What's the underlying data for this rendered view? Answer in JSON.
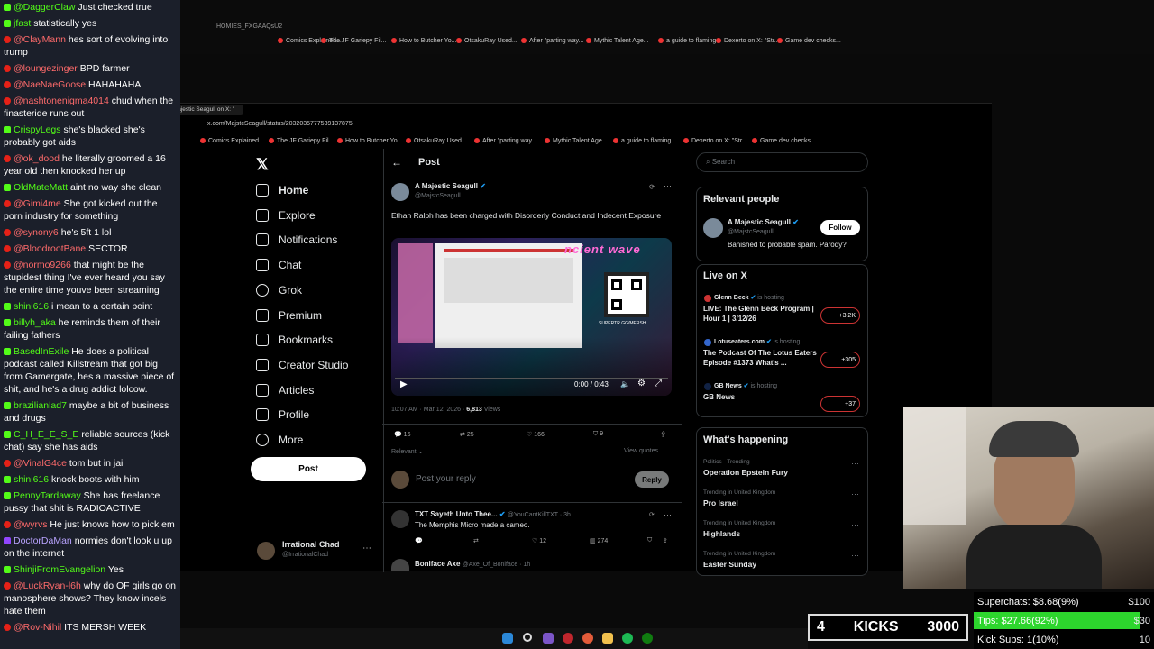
{
  "chat": [
    {
      "badge": "kick",
      "user": "@DaggerClaw",
      "text": "Just checked true"
    },
    {
      "badge": "kick",
      "user": "jfast",
      "text": "statistically yes"
    },
    {
      "badge": "yt",
      "user": "@ClayMann",
      "text": "hes sort of evolving into trump"
    },
    {
      "badge": "yt",
      "user": "@loungezinger",
      "text": "BPD farmer"
    },
    {
      "badge": "yt",
      "user": "@NaeNaeGoose",
      "text": "HAHAHAHA"
    },
    {
      "badge": "yt",
      "user": "@nashtonenigma4014",
      "text": "chud when the finasteride runs out"
    },
    {
      "badge": "kick",
      "user": "CrispyLegs",
      "text": "she's blacked she's probably got aids"
    },
    {
      "badge": "yt",
      "user": "@ok_dood",
      "text": "he literally groomed a 16 year old then knocked her up"
    },
    {
      "badge": "kick",
      "user": "OldMateMatt",
      "text": "aint no way she clean"
    },
    {
      "badge": "yt",
      "user": "@Gimi4me",
      "text": "She got kicked out the porn industry for something"
    },
    {
      "badge": "yt",
      "user": "@synony6",
      "text": "he's 5ft 1 lol"
    },
    {
      "badge": "yt",
      "user": "@BloodrootBane",
      "text": "SECTOR"
    },
    {
      "badge": "yt",
      "user": "@normo9266",
      "text": "that might be the stupidest thing I've ever heard you say the entire time youve been streaming"
    },
    {
      "badge": "kick",
      "user": "shini616",
      "text": "i mean to a certain point"
    },
    {
      "badge": "kick",
      "user": "billyh_aka",
      "text": "he reminds them of their failing fathers"
    },
    {
      "badge": "kick",
      "user": "BasedInExile",
      "text": "He does a political podcast called Killstream that got big from Gamergate, hes a massive piece of shit, and he's a drug addict lolcow."
    },
    {
      "badge": "kick",
      "user": "brazilianlad7",
      "text": "maybe a bit of business and drugs"
    },
    {
      "badge": "kick",
      "user": "C_H_E_E_S_E",
      "text": "reliable sources (kick chat) say she has aids"
    },
    {
      "badge": "yt",
      "user": "@VinalG4ce",
      "text": "tom but in jail"
    },
    {
      "badge": "kick",
      "user": "shini616",
      "text": "knock boots with him"
    },
    {
      "badge": "kick",
      "user": "PennyTardaway",
      "text": "She has freelance pussy that shit is RADIOACTIVE"
    },
    {
      "badge": "yt",
      "user": "@wyrvs",
      "text": "He just knows how to pick em"
    },
    {
      "badge": "tw",
      "user": "DoctorDaMan",
      "text": "normies don't look u up on the internet"
    },
    {
      "badge": "kick",
      "user": "ShinjiFromEvangelion",
      "text": "Yes"
    },
    {
      "badge": "yt",
      "user": "@LuckRyan-l6h",
      "text": "why do OF girls go on manosphere shows? They know incels hate them"
    },
    {
      "badge": "yt",
      "user": "@Rov-Nihil",
      "text": "ITS MERSH WEEK"
    }
  ],
  "browser": {
    "tab_back": "HOMIES_FXGAAQsU2",
    "tab_front": "A Majestic Seagull on X: \"",
    "url": "x.com/MajstcSeagull/status/2032035777539137875",
    "bookmarks": [
      "Comics Explained...",
      "The JF Gariepy Fil...",
      "How to Butcher Yo...",
      "OtsakuRay Used...",
      "After \"parting way...",
      "Mythic Talent Age...",
      "a guide to flaming...",
      "Dexerto on X: \"Str...",
      "Game dev checks..."
    ]
  },
  "x_nav": {
    "items": [
      "Home",
      "Explore",
      "Notifications",
      "Chat",
      "Grok",
      "Premium",
      "Bookmarks",
      "Creator Studio",
      "Articles",
      "Profile",
      "More"
    ],
    "post_button": "Post",
    "account_name": "Irrational Chad",
    "account_handle": "@IrrationalChad"
  },
  "post": {
    "header": "Post",
    "author": "A Majestic Seagull",
    "handle": "@MajstcSeagull",
    "text": "Ethan Ralph has been charged with Disorderly Conduct and Indecent Exposure",
    "video_time": "0:00 / 0:43",
    "video_overlay": "SUPERTR.GG/MERSH",
    "timestamp": "10:07 AM · Mar 12, 2026 · ",
    "views": "6,813",
    "views_label": " Views",
    "replies": "16",
    "reposts": "25",
    "likes": "166",
    "bookmarks": "9",
    "relevant": "Relevant",
    "view_quotes": "View quotes",
    "reply_placeholder": "Post your reply",
    "reply_button": "Reply"
  },
  "replies": [
    {
      "author": "TXT Sayeth Unto Thee...",
      "handle": "@YouCantKillTXT · 3h",
      "text": "The Memphis Micro made a cameo.",
      "likes": "12",
      "views": "274"
    },
    {
      "author": "Boniface Axe",
      "handle": "@Axe_Of_Boniface · 1h",
      "text": ""
    }
  ],
  "right": {
    "search_placeholder": "Search",
    "relevant_title": "Relevant people",
    "rp_name": "A Majestic Seagull",
    "rp_handle": "@MajstcSeagull",
    "rp_bio": "Banished to probable spam. Parody?",
    "follow": "Follow",
    "live_title": "Live on X",
    "live": [
      {
        "host": "Glenn Beck",
        "hosting": "is hosting",
        "title": "LIVE: The Glenn Beck Program | Hour 1 | 3/12/26",
        "count": "+3.2K"
      },
      {
        "host": "Lotuseaters.com",
        "hosting": "is hosting",
        "title": "The Podcast Of The Lotus Eaters Episode #1373 What's ...",
        "count": "+305"
      },
      {
        "host": "GB News",
        "hosting": "is hosting",
        "title": "GB News",
        "count": "+37"
      }
    ],
    "happening_title": "What's happening",
    "trends": [
      {
        "meta": "Politics · Trending",
        "name": "Operation Epstein Fury"
      },
      {
        "meta": "Trending in United Kingdom",
        "name": "Pro Israel"
      },
      {
        "meta": "Trending in United Kingdom",
        "name": "Highlands"
      },
      {
        "meta": "Trending in United Kingdom",
        "name": "Easter Sunday"
      }
    ]
  },
  "kicks": {
    "count": "4",
    "label": "KICKS",
    "goal": "3000"
  },
  "stats": [
    {
      "label": "Superchats: $8.68(9%)",
      "value": "$100",
      "fill": 0
    },
    {
      "label": "Tips: $27.66(92%)",
      "value": "$30",
      "fill": 0.92
    },
    {
      "label": "Kick Subs: 1(10%)",
      "value": "10",
      "fill": 0
    }
  ],
  "colors": {
    "kick": "#53fc18",
    "youtube": "#e62117",
    "accent": "#1d9bf0",
    "stat_fill": "#2dd62d"
  }
}
